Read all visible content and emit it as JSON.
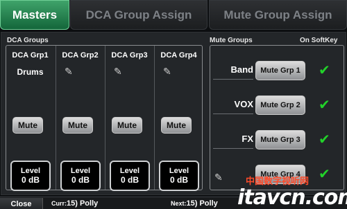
{
  "tabs": [
    {
      "label": "Masters",
      "active": true
    },
    {
      "label": "DCA Group Assign",
      "active": false
    },
    {
      "label": "Mute Group Assign",
      "active": false
    }
  ],
  "dca": {
    "title": "DCA Groups",
    "groups": [
      {
        "name": "DCA Grp1",
        "label": "Drums",
        "mute": "Mute",
        "level_title": "Level",
        "level": "0 dB"
      },
      {
        "name": "DCA Grp2",
        "label": "",
        "mute": "Mute",
        "level_title": "Level",
        "level": "0 dB"
      },
      {
        "name": "DCA Grp3",
        "label": "",
        "mute": "Mute",
        "level_title": "Level",
        "level": "0 dB"
      },
      {
        "name": "DCA Grp4",
        "label": "",
        "mute": "Mute",
        "level_title": "Level",
        "level": "0 dB"
      }
    ]
  },
  "mute": {
    "title": "Mute Groups",
    "softkey_title": "On SoftKey",
    "groups": [
      {
        "label": "Band",
        "button": "Mute Grp 1",
        "on_softkey": true
      },
      {
        "label": "VOX",
        "button": "Mute Grp 2",
        "on_softkey": true
      },
      {
        "label": "FX",
        "button": "Mute Grp 3",
        "on_softkey": true
      },
      {
        "label": "",
        "button": "Mute Grp 4",
        "on_softkey": true
      }
    ]
  },
  "bottom": {
    "close": "Close",
    "curr_key": "Curr:",
    "curr_value": "15) Polly",
    "next_key": "Next:",
    "next_value": "15) Polly"
  },
  "watermark": {
    "cn": "中国数字视听网",
    "text": "itavcn.com"
  },
  "icons": {
    "edit": "pencil-icon",
    "check": "checkmark-icon"
  },
  "colors": {
    "active_tab": "#2a8a55",
    "check": "#22d22a"
  }
}
